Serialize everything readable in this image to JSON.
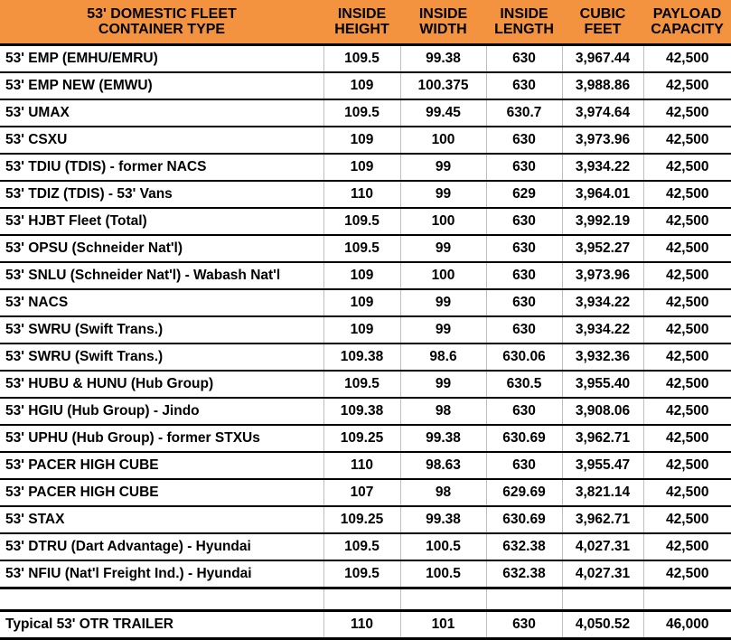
{
  "table": {
    "header": {
      "title_line1": "53' DOMESTIC FLEET",
      "title_line2": "CONTAINER TYPE",
      "col_height_line1": "INSIDE",
      "col_height_line2": "HEIGHT",
      "col_width_line1": "INSIDE",
      "col_width_line2": "WIDTH",
      "col_length_line1": "INSIDE",
      "col_length_line2": "LENGTH",
      "col_cubic_line1": "CUBIC",
      "col_cubic_line2": "FEET",
      "col_payload_line1": "PAYLOAD",
      "col_payload_line2": "CAPACITY",
      "background_color": "#F4933F"
    },
    "columns": [
      "53' DOMESTIC FLEET CONTAINER TYPE",
      "INSIDE HEIGHT",
      "INSIDE WIDTH",
      "INSIDE LENGTH",
      "CUBIC FEET",
      "PAYLOAD CAPACITY"
    ],
    "rows": [
      {
        "type": "53' EMP (EMHU/EMRU)",
        "inside_height": "109.5",
        "inside_width": "99.38",
        "inside_length": "630",
        "cubic_feet": "3,967.44",
        "payload_capacity": "42,500",
        "blank": false
      },
      {
        "type": "53' EMP NEW (EMWU)",
        "inside_height": "109",
        "inside_width": "100.375",
        "inside_length": "630",
        "cubic_feet": "3,988.86",
        "payload_capacity": "42,500",
        "blank": false
      },
      {
        "type": "53' UMAX",
        "inside_height": "109.5",
        "inside_width": "99.45",
        "inside_length": "630.7",
        "cubic_feet": "3,974.64",
        "payload_capacity": "42,500",
        "blank": false
      },
      {
        "type": "53' CSXU",
        "inside_height": "109",
        "inside_width": "100",
        "inside_length": "630",
        "cubic_feet": "3,973.96",
        "payload_capacity": "42,500",
        "blank": false
      },
      {
        "type": "53' TDIU (TDIS) - former NACS",
        "inside_height": "109",
        "inside_width": "99",
        "inside_length": "630",
        "cubic_feet": "3,934.22",
        "payload_capacity": "42,500",
        "blank": false
      },
      {
        "type": "53' TDIZ (TDIS) - 53' Vans",
        "inside_height": "110",
        "inside_width": "99",
        "inside_length": "629",
        "cubic_feet": "3,964.01",
        "payload_capacity": "42,500",
        "blank": false
      },
      {
        "type": "53' HJBT Fleet (Total)",
        "inside_height": "109.5",
        "inside_width": "100",
        "inside_length": "630",
        "cubic_feet": "3,992.19",
        "payload_capacity": "42,500",
        "blank": false
      },
      {
        "type": "53' OPSU (Schneider Nat'l)",
        "inside_height": "109.5",
        "inside_width": "99",
        "inside_length": "630",
        "cubic_feet": "3,952.27",
        "payload_capacity": "42,500",
        "blank": false
      },
      {
        "type": "53' SNLU (Schneider Nat'l) - Wabash Nat'l",
        "inside_height": "109",
        "inside_width": "100",
        "inside_length": "630",
        "cubic_feet": "3,973.96",
        "payload_capacity": "42,500",
        "blank": false
      },
      {
        "type": "53' NACS",
        "inside_height": "109",
        "inside_width": "99",
        "inside_length": "630",
        "cubic_feet": "3,934.22",
        "payload_capacity": "42,500",
        "blank": false
      },
      {
        "type": "53' SWRU (Swift Trans.)",
        "inside_height": "109",
        "inside_width": "99",
        "inside_length": "630",
        "cubic_feet": "3,934.22",
        "payload_capacity": "42,500",
        "blank": false
      },
      {
        "type": "53' SWRU (Swift Trans.)",
        "inside_height": "109.38",
        "inside_width": "98.6",
        "inside_length": "630.06",
        "cubic_feet": "3,932.36",
        "payload_capacity": "42,500",
        "blank": false
      },
      {
        "type": "53' HUBU & HUNU (Hub Group)",
        "inside_height": "109.5",
        "inside_width": "99",
        "inside_length": "630.5",
        "cubic_feet": "3,955.40",
        "payload_capacity": "42,500",
        "blank": false
      },
      {
        "type": "53' HGIU (Hub Group) - Jindo",
        "inside_height": "109.38",
        "inside_width": "98",
        "inside_length": "630",
        "cubic_feet": "3,908.06",
        "payload_capacity": "42,500",
        "blank": false
      },
      {
        "type": "53' UPHU (Hub Group) - former STXUs",
        "inside_height": "109.25",
        "inside_width": "99.38",
        "inside_length": "630.69",
        "cubic_feet": "3,962.71",
        "payload_capacity": "42,500",
        "blank": false
      },
      {
        "type": "53' PACER HIGH CUBE",
        "inside_height": "110",
        "inside_width": "98.63",
        "inside_length": "630",
        "cubic_feet": "3,955.47",
        "payload_capacity": "42,500",
        "blank": false
      },
      {
        "type": "53' PACER HIGH CUBE",
        "inside_height": "107",
        "inside_width": "98",
        "inside_length": "629.69",
        "cubic_feet": "3,821.14",
        "payload_capacity": "42,500",
        "blank": false
      },
      {
        "type": "53' STAX",
        "inside_height": "109.25",
        "inside_width": "99.38",
        "inside_length": "630.69",
        "cubic_feet": "3,962.71",
        "payload_capacity": "42,500",
        "blank": false
      },
      {
        "type": "53' DTRU (Dart Advantage) - Hyundai",
        "inside_height": "109.5",
        "inside_width": "100.5",
        "inside_length": "632.38",
        "cubic_feet": "4,027.31",
        "payload_capacity": "42,500",
        "blank": false
      },
      {
        "type": "53' NFIU (Nat'l Freight Ind.) - Hyundai",
        "inside_height": "109.5",
        "inside_width": "100.5",
        "inside_length": "632.38",
        "cubic_feet": "4,027.31",
        "payload_capacity": "42,500",
        "blank": false
      },
      {
        "type": "",
        "inside_height": "",
        "inside_width": "",
        "inside_length": "",
        "cubic_feet": "",
        "payload_capacity": "",
        "blank": true
      },
      {
        "type": "Typical 53' OTR TRAILER",
        "inside_height": "110",
        "inside_width": "101",
        "inside_length": "630",
        "cubic_feet": "4,050.52",
        "payload_capacity": "46,000",
        "blank": false
      }
    ]
  }
}
